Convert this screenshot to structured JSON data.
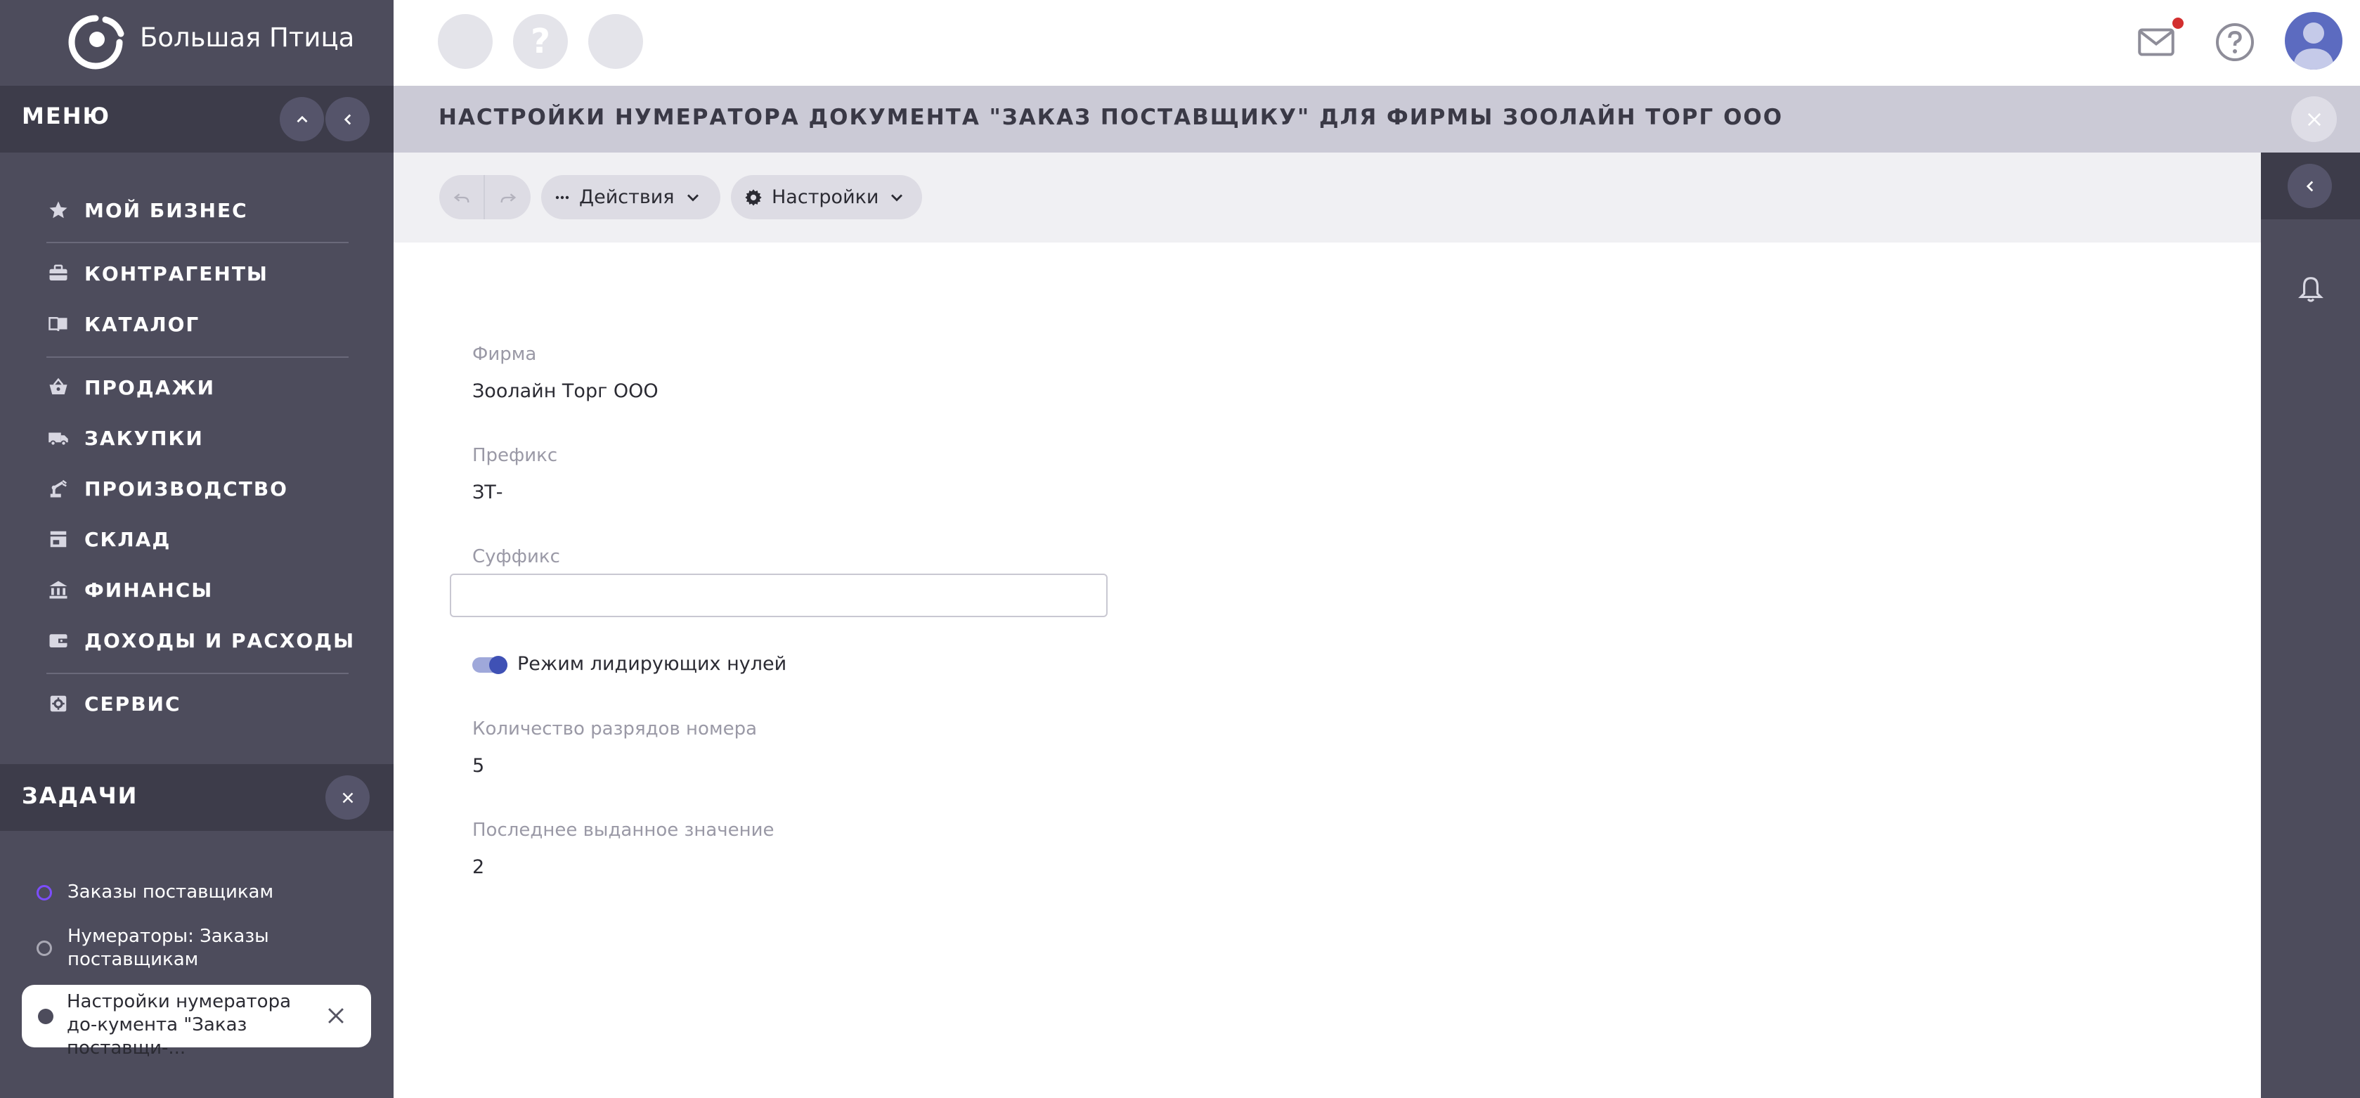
{
  "brand": {
    "name": "Большая Птица"
  },
  "menu": {
    "title": "МЕНЮ",
    "items": [
      {
        "label": "МОЙ БИЗНЕС",
        "icon": "star-icon"
      },
      {
        "label": "КОНТРАГЕНТЫ",
        "icon": "briefcase-icon"
      },
      {
        "label": "КАТАЛОГ",
        "icon": "book-icon"
      },
      {
        "label": "ПРОДАЖИ",
        "icon": "basket-icon"
      },
      {
        "label": "ЗАКУПКИ",
        "icon": "truck-icon"
      },
      {
        "label": "ПРОИЗВОДСТВО",
        "icon": "robot-arm-icon"
      },
      {
        "label": "СКЛАД",
        "icon": "store-icon"
      },
      {
        "label": "ФИНАНСЫ",
        "icon": "bank-icon"
      },
      {
        "label": "ДОХОДЫ И РАСХОДЫ",
        "icon": "wallet-icon"
      },
      {
        "label": "СЕРВИС",
        "icon": "service-icon"
      }
    ]
  },
  "tasks": {
    "title": "ЗАДАЧИ",
    "items": [
      {
        "label": "Заказы поставщикам",
        "status": "active"
      },
      {
        "label": "Нумераторы: Заказы поставщикам",
        "status": "inactive"
      },
      {
        "label": "Настройки нумератора до-кумента \"Заказ поставщи-...",
        "status": "current"
      }
    ]
  },
  "page": {
    "title": "НАСТРОЙКИ НУМЕРАТОРА ДОКУМЕНТА \"ЗАКАЗ ПОСТАВЩИКУ\" ДЛЯ ФИРМЫ ЗООЛАЙН ТОРГ ООО"
  },
  "toolbar": {
    "actions_label": "Действия",
    "settings_label": "Настройки"
  },
  "topbar": {
    "placeholder_2_glyph": "?"
  },
  "form": {
    "firm_label": "Фирма",
    "firm_value": "Зоолайн Торг ООО",
    "prefix_label": "Префикс",
    "prefix_value": "ЗТ-",
    "suffix_label": "Суффикс",
    "suffix_value": "",
    "leading_zeros_label": "Режим лидирующих нулей",
    "leading_zeros_enabled": true,
    "digits_label": "Количество разрядов номера",
    "digits_value": "5",
    "last_value_label": "Последнее выданное значение",
    "last_value": "2"
  },
  "colors": {
    "sidebar": "#4d4c5c",
    "sidebar_header": "#3d3c4a",
    "title_bar": "#cbcad6",
    "toolbar": "#f0f0f3",
    "accent": "#3f51b5",
    "task_active_dot": "#7c4dff",
    "notification": "#d32f2f"
  }
}
